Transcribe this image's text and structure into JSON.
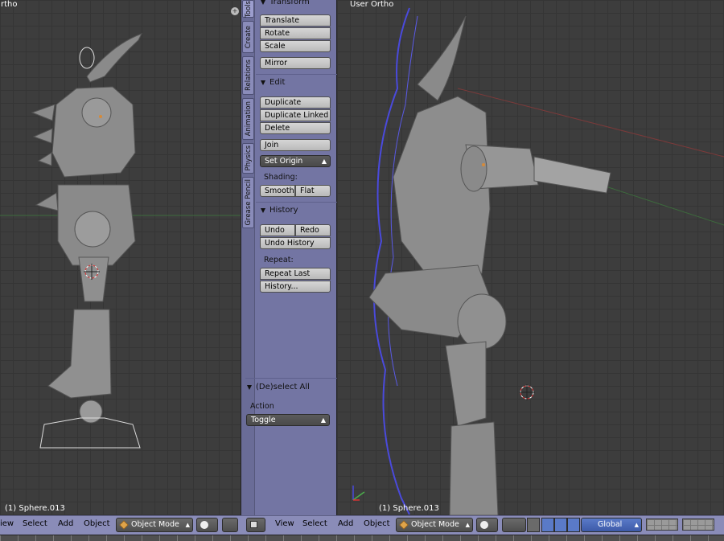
{
  "left_view": {
    "title": "rtho",
    "status": "(1) Sphere.013"
  },
  "right_view": {
    "title": "User Ortho",
    "status": "(1) Sphere.013"
  },
  "tabs": [
    "Tools",
    "Create",
    "Relations",
    "Animation",
    "Physics",
    "Grease Pencil"
  ],
  "transform": {
    "header": "Transform",
    "translate": "Translate",
    "rotate": "Rotate",
    "scale": "Scale",
    "mirror": "Mirror"
  },
  "edit": {
    "header": "Edit",
    "duplicate": "Duplicate",
    "duplicate_linked": "Duplicate Linked",
    "delete": "Delete",
    "join": "Join",
    "set_origin": "Set Origin",
    "shading_label": "Shading:",
    "smooth": "Smooth",
    "flat": "Flat"
  },
  "history": {
    "header": "History",
    "undo": "Undo",
    "redo": "Redo",
    "undo_history": "Undo History",
    "repeat_label": "Repeat:",
    "repeat_last": "Repeat Last",
    "history": "History..."
  },
  "operator": {
    "header": "(De)select All",
    "action_label": "Action",
    "action_value": "Toggle"
  },
  "header_left": {
    "view": "iew",
    "select": "Select",
    "add": "Add",
    "object": "Object",
    "mode": "Object Mode"
  },
  "header_right": {
    "view": "View",
    "select": "Select",
    "add": "Add",
    "object": "Object",
    "mode": "Object Mode",
    "orientation": "Global"
  },
  "colors": {
    "accent": "#7375a3",
    "header": "#8a8cb8",
    "viewport": "#3d3d3d",
    "wire": "#4a4adc"
  }
}
